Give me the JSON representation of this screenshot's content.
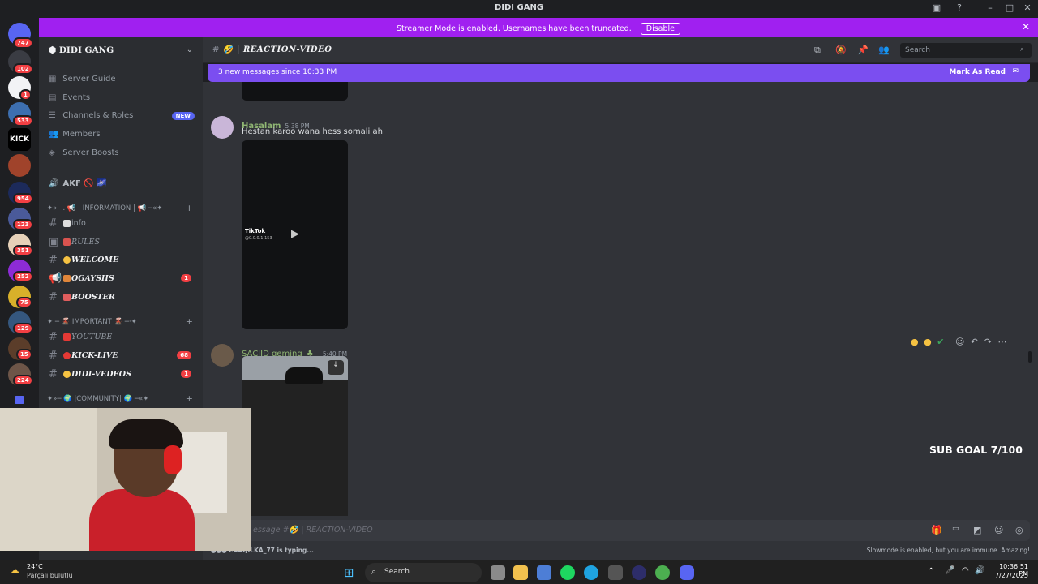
{
  "app": {
    "title": "DIDI GANG"
  },
  "banner": {
    "text": "Streamer Mode is enabled. Usernames have been truncated.",
    "button": "Disable"
  },
  "rail": {
    "badges": [
      "747",
      "102",
      "1",
      "533",
      "954",
      "123",
      "351",
      "252",
      "75",
      "129",
      "15",
      "224"
    ],
    "kick_label": "KICK"
  },
  "sidebar": {
    "server_name": "DIDI GANG",
    "nav": [
      {
        "label": "Server Guide",
        "icon": "map-icon"
      },
      {
        "label": "Events",
        "icon": "calendar-icon"
      },
      {
        "label": "Channels & Roles",
        "icon": "list-icon"
      },
      {
        "label": "Members",
        "icon": "members-icon"
      },
      {
        "label": "Server Boosts",
        "icon": "boost-icon"
      }
    ],
    "new_badge": "NEW",
    "voice_channel": "AKF",
    "categories": [
      {
        "label": "✦»−. 📢 | INFORMATION | 📢 ─«✦"
      },
      {
        "label": "✦·─ 🌋 IMPORTANT 🌋 ─·✦"
      },
      {
        "label": "✦»─ 🌍 |COMMUNITY| 🌍 ─«✦"
      }
    ],
    "channels": [
      {
        "name": "info",
        "unread": ""
      },
      {
        "name": "RULES",
        "unread": ""
      },
      {
        "name": "WELCOME",
        "unread": ""
      },
      {
        "name": "OGAYSIIS",
        "unread": "1"
      },
      {
        "name": "BOOSTER",
        "unread": ""
      },
      {
        "name": "YOUTUBE",
        "unread": ""
      },
      {
        "name": "KICK-LIVE",
        "unread": "68"
      },
      {
        "name": "DIDI-VEDEOS",
        "unread": "1"
      }
    ]
  },
  "header": {
    "channel_name": "REACTION-VIDEO",
    "search_placeholder": "Search"
  },
  "newbar": {
    "text": "3 new messages since 10:33 PM",
    "action": "Mark As Read"
  },
  "messages": [
    {
      "user": "Hasalam",
      "time": "5:38 PM",
      "text": "Hestan karoo wana hess somali ah",
      "media_label": "TikTok",
      "media_sub": "@0.0.0.1.153"
    },
    {
      "user": "SACIID geming",
      "time": "5:40 PM"
    }
  ],
  "overlay": {
    "subgoal": "SUB GOAL 7/100"
  },
  "composer": {
    "placeholder": "essage #🤣 | REACTION-VIDEO"
  },
  "typing": {
    "text": "CAAQILKA_77 is typing...",
    "slowmode": "Slowmode is enabled, but you are immune. Amazing!"
  },
  "taskbar": {
    "weather_temp": "24°C",
    "weather_desc": "Parçalı bulutlu",
    "search": "Search",
    "time": "10:36:51 PM",
    "date": "7/27/2025"
  },
  "colors": {
    "accent": "#a020f0",
    "newbar": "#7b4ef0",
    "sidebar": "#2b2d31",
    "chat": "#313338",
    "username2": "#8fb573"
  }
}
